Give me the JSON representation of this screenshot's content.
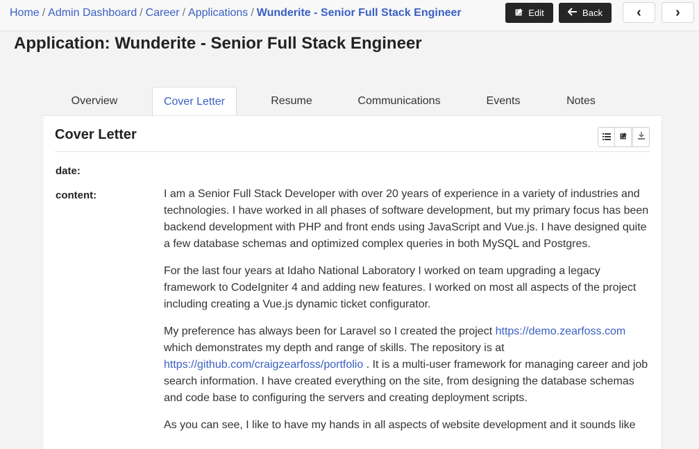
{
  "breadcrumb": {
    "items": [
      "Home",
      "Admin Dashboard",
      "Career",
      "Applications"
    ],
    "separator": "/",
    "current": "Wunderite - Senior Full Stack Engineer"
  },
  "toolbar": {
    "edit_label": "Edit",
    "back_label": "Back",
    "prev_label": "‹",
    "next_label": "›"
  },
  "page": {
    "title": "Application: Wunderite - Senior Full Stack Engineer"
  },
  "tabs": [
    "Overview",
    "Cover Letter",
    "Resume",
    "Communications",
    "Events",
    "Notes"
  ],
  "active_tab": "Cover Letter",
  "panel": {
    "title": "Cover Letter",
    "icons": [
      "list-icon",
      "edit-icon",
      "download-icon"
    ],
    "fields": {
      "date_label": "date:",
      "content_label": "content:"
    },
    "paragraphs": {
      "p1": "I am a Senior Full Stack Developer with over 20 years of experience in a variety of industries and technologies. I have worked in all phases of software development, but my primary focus has been backend development with PHP and front ends using JavaScript and Vue.js. I have designed quite a few database schemas and optimized complex queries in both MySQL and Postgres.",
      "p2": "For the last four years at Idaho National Laboratory I worked on team upgrading a legacy framework to CodeIgniter 4 and adding new features. I worked on most all aspects of the project including creating a Vue.js dynamic ticket configurator.",
      "p3_a": "My preference has always been for Laravel so I created the project ",
      "p3_link1": "https://demo.zearfoss.com",
      "p3_b": " which demonstrates my depth and range of skills. The repository is at ",
      "p3_link2": "https://github.com/craigzearfoss/portfolio",
      "p3_c": " . It is a multi-user framework for managing career and job search information. I have created everything on the site, from designing the database schemas and code base to configuring the servers and creating deployment scripts.",
      "p4": " As you can see, I like to have my hands in all aspects of website development and it sounds like"
    }
  },
  "colors": {
    "link": "#3a5fc4",
    "dark_button": "#262626",
    "page_bg": "#f3f3f3"
  }
}
